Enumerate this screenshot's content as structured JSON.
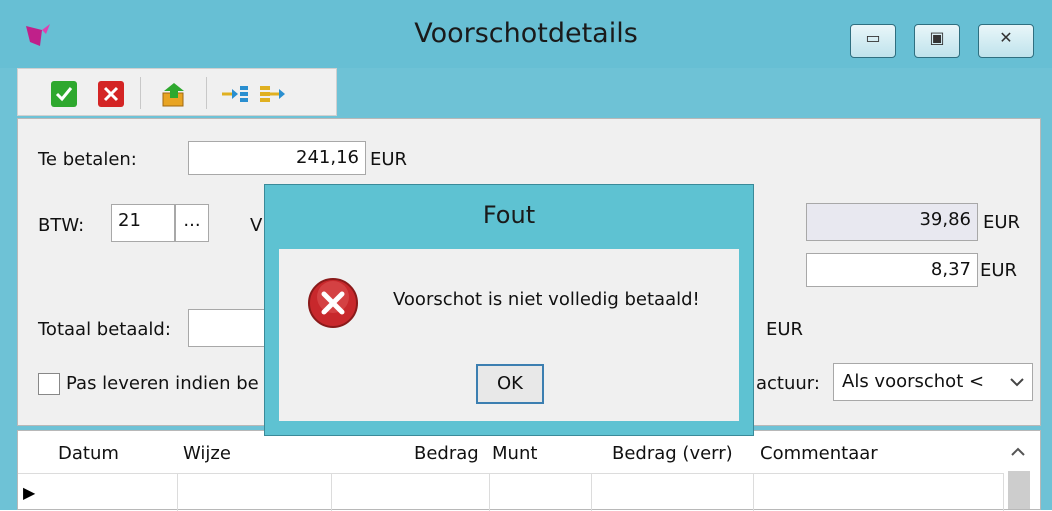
{
  "window": {
    "title": "Voorschotdetails",
    "controls": {
      "minimize": "▭",
      "maximize": "▣",
      "close": "✕"
    }
  },
  "toolbar": {
    "items": [
      {
        "icon": "check-icon",
        "color": "#2ea82e"
      },
      {
        "icon": "cancel-icon",
        "color": "#d42525"
      },
      {
        "icon": "export-icon",
        "color": "#e8a423"
      },
      {
        "icon": "move-in-icon",
        "color": "#e0b020"
      },
      {
        "icon": "move-out-icon",
        "color": "#e0b020"
      }
    ]
  },
  "form": {
    "te_betalen_label": "Te betalen:",
    "te_betalen_value": "241,16",
    "currency": "EUR",
    "btw_label": "BTW:",
    "btw_value": "21",
    "btw_button": "...",
    "partial_label_char": "V",
    "right_value_1": "39,86",
    "right_value_2": "8,37",
    "totaal_betaald_label": "Totaal betaald:",
    "pas_leveren_label": "Pas leveren indien be",
    "factuur_label": "actuur:",
    "factuur_value": "Als voorschot <"
  },
  "grid": {
    "columns": [
      "Datum",
      "Wijze",
      "Bedrag",
      "Munt",
      "Bedrag (verr)",
      "Commentaar"
    ],
    "row_indicator": "▶"
  },
  "dialog": {
    "title": "Fout",
    "message": "Voorschot is niet volledig betaald!",
    "ok_label": "OK",
    "icon": "error-icon"
  }
}
